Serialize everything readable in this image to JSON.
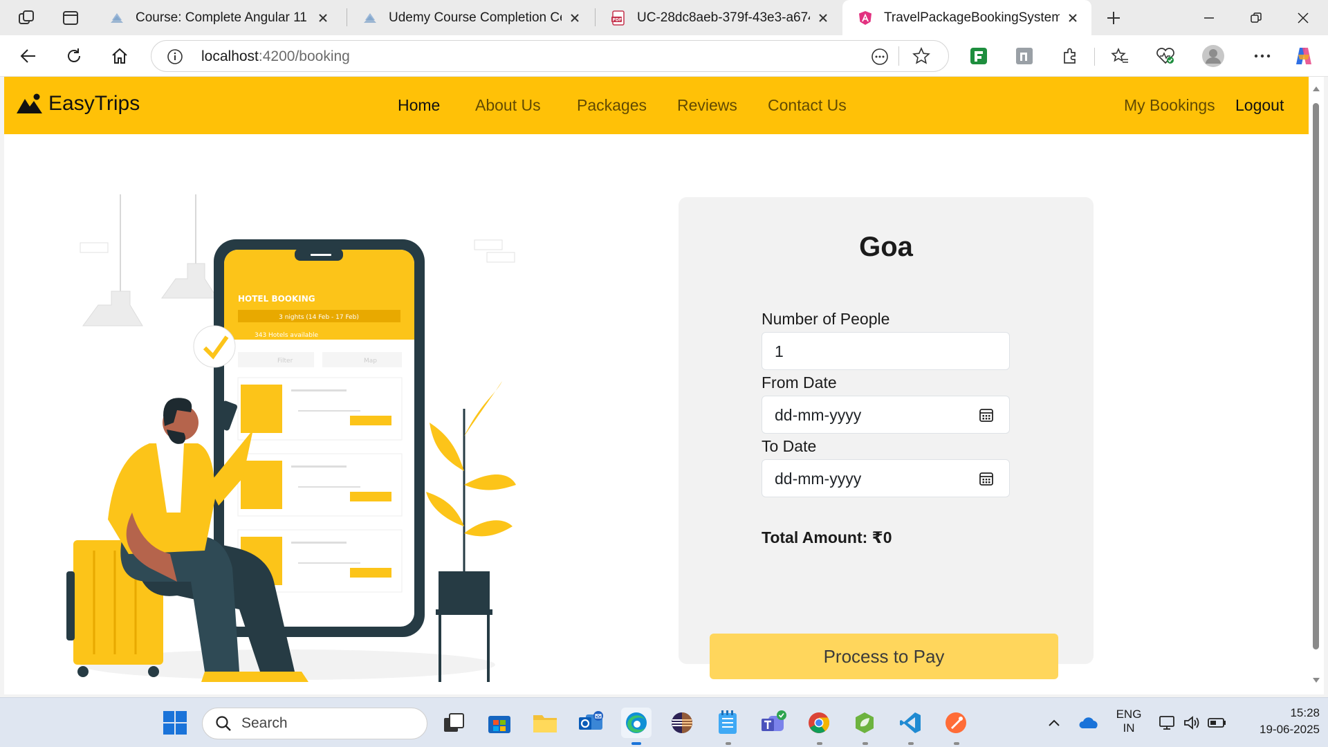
{
  "browser": {
    "tabs": [
      {
        "title": "Course: Complete Angular 11 - Ul",
        "active": false
      },
      {
        "title": "Udemy Course Completion Certific",
        "active": false
      },
      {
        "title": "UC-28dc8aeb-379f-43e3-a674-c5",
        "active": false
      },
      {
        "title": "TravelPackageBookingSystem",
        "active": true
      }
    ],
    "url_host": "localhost",
    "url_path": ":4200/booking"
  },
  "navbar": {
    "brand": "EasyTrips",
    "links": [
      "Home",
      "About Us",
      "Packages",
      "Reviews",
      "Contact Us"
    ],
    "right_links": [
      "My Bookings",
      "Logout"
    ],
    "active_link": "Home",
    "bg_color": "#ffc107"
  },
  "illustration": {
    "header": "HOTEL BOOKING",
    "dates": "3 nights (14 Feb - 17 Feb)",
    "hotels": "343 Hotels available",
    "filter": "Filter",
    "map": "Map"
  },
  "booking": {
    "destination": "Goa",
    "people_label": "Number of People",
    "people_value": "1",
    "from_label": "From Date",
    "from_value": "dd-mm-yyyy",
    "to_label": "To Date",
    "to_value": "dd-mm-yyyy",
    "total": "Total Amount: ₹0",
    "pay_button": "Process to Pay"
  },
  "taskbar": {
    "search": "Search",
    "lang_1": "ENG",
    "lang_2": "IN",
    "time": "15:28",
    "date": "19-06-2025"
  }
}
